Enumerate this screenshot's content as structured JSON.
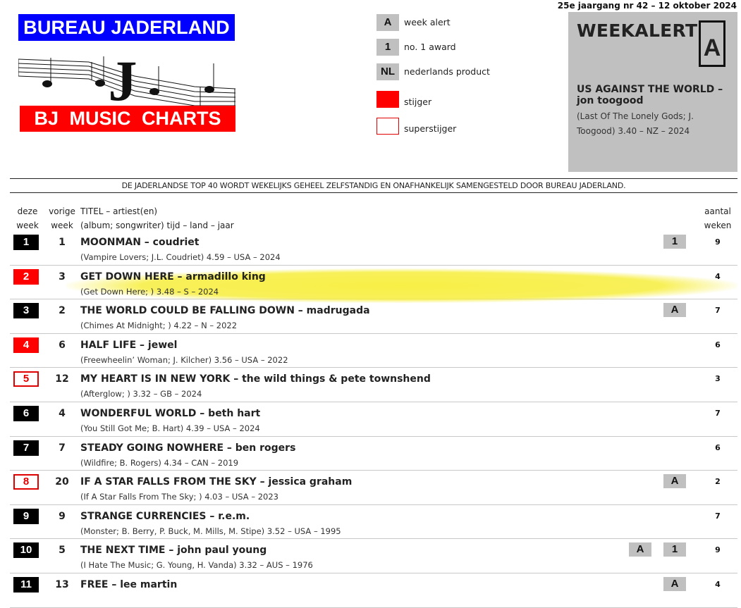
{
  "logo": {
    "top_text": "BUREAU JADERLAND",
    "bottom_text": "BJ MUSIC CHARTS",
    "emblem_letter": "J",
    "colors": {
      "top_bg": "#0000ff",
      "bottom_bg": "#ff0000"
    }
  },
  "legend": [
    {
      "badge": "A",
      "label": "week alert",
      "type": "grey"
    },
    {
      "badge": "1",
      "label": "no. 1 award",
      "type": "grey"
    },
    {
      "badge": "NL",
      "label": "nederlands product",
      "type": "grey"
    },
    {
      "badge": "",
      "label": "stijger",
      "type": "red"
    },
    {
      "badge": "",
      "label": "superstijger",
      "type": "outline"
    }
  ],
  "issue": "25e jaargang nr 42 – 12 oktober 2024",
  "weekalert": {
    "title": "WEEKALERT",
    "badge": "A",
    "song": "US AGAINST THE WORLD – jon toogood",
    "meta": "(Last Of The Lonely Gods; J. Toogood) 3.40 – NZ – 2024"
  },
  "notice": "DE JADERLANDSE TOP 40 WORDT WEKELIJKS GEHEEL ZELFSTANDIG EN ONAFHANKELIJK SAMENGESTELD DOOR BUREAU JADERLAND.",
  "headers": {
    "this_week": [
      "deze",
      "week"
    ],
    "prev_week": [
      "vorige",
      "week"
    ],
    "title": [
      "TITEL – artiest(en)",
      "(album; songwriter) tijd – land – jaar"
    ],
    "weeks": [
      "aantal",
      "weken"
    ]
  },
  "colors": {
    "stijger": "#ff0000",
    "superstijger": "#e00000",
    "badge_bg": "#c0c0c0",
    "highlight": "#f7ee3c"
  },
  "rows": [
    {
      "pos": "1",
      "status": "normal",
      "prev": "1",
      "title": "MOONMAN – coudriet",
      "meta": "(Vampire Lovers; J.L. Coudriet) 4.59 – USA – 2024",
      "badges": [
        "1"
      ],
      "weeks": "9",
      "highlight": false
    },
    {
      "pos": "2",
      "status": "stijger",
      "prev": "3",
      "title": "GET DOWN HERE – armadillo king",
      "meta": "(Get Down Here; ) 3.48 – S – 2024",
      "badges": [],
      "weeks": "4",
      "highlight": true
    },
    {
      "pos": "3",
      "status": "normal",
      "prev": "2",
      "title": "THE WORLD COULD BE FALLING DOWN – madrugada",
      "meta": "(Chimes At Midnight; ) 4.22 – N – 2022",
      "badges": [
        "A"
      ],
      "weeks": "7",
      "highlight": false
    },
    {
      "pos": "4",
      "status": "stijger",
      "prev": "6",
      "title": "HALF LIFE – jewel",
      "meta": "(Freewheelin’ Woman; J. Kilcher) 3.56 – USA – 2022",
      "badges": [],
      "weeks": "6",
      "highlight": false
    },
    {
      "pos": "5",
      "status": "superstijger",
      "prev": "12",
      "title": "MY HEART IS IN NEW YORK – the wild things & pete townshend",
      "meta": "(Afterglow; ) 3.32 – GB – 2024",
      "badges": [],
      "weeks": "3",
      "highlight": false
    },
    {
      "pos": "6",
      "status": "normal",
      "prev": "4",
      "title": "WONDERFUL WORLD – beth hart",
      "meta": "(You Still Got Me; B. Hart) 4.39 – USA – 2024",
      "badges": [],
      "weeks": "7",
      "highlight": false
    },
    {
      "pos": "7",
      "status": "normal",
      "prev": "7",
      "title": "STEADY GOING NOWHERE – ben rogers",
      "meta": "(Wildfire; B. Rogers) 4.34 – CAN – 2019",
      "badges": [],
      "weeks": "6",
      "highlight": false
    },
    {
      "pos": "8",
      "status": "superstijger",
      "prev": "20",
      "title": "IF A STAR FALLS FROM THE SKY – jessica graham",
      "meta": "(If A Star Falls From The Sky; ) 4.03 – USA – 2023",
      "badges": [
        "A"
      ],
      "weeks": "2",
      "highlight": false
    },
    {
      "pos": "9",
      "status": "normal",
      "prev": "9",
      "title": "STRANGE CURRENCIES – r.e.m.",
      "meta": "(Monster; B. Berry, P. Buck, M. Mills, M. Stipe) 3.52 – USA – 1995",
      "badges": [],
      "weeks": "7",
      "highlight": false
    },
    {
      "pos": "10",
      "status": "normal",
      "prev": "5",
      "title": "THE NEXT TIME – john paul young",
      "meta": "(I Hate The Music; G. Young, H. Vanda) 3.32 – AUS – 1976",
      "badges": [
        "1",
        "A"
      ],
      "weeks": "9",
      "highlight": false
    },
    {
      "pos": "11",
      "status": "normal",
      "prev": "13",
      "title": "FREE – lee martin",
      "meta": "",
      "badges": [
        "A"
      ],
      "weeks": "4",
      "highlight": false
    }
  ]
}
